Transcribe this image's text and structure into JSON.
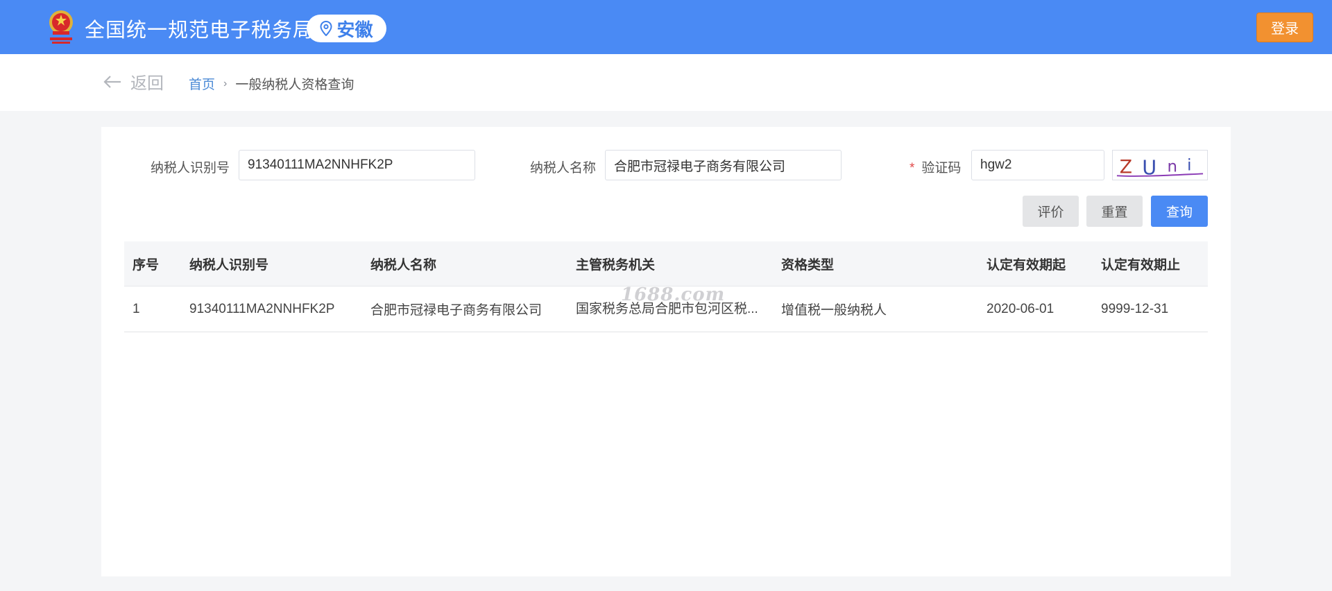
{
  "header": {
    "site_title": "全国统一规范电子税务局",
    "region": "安徽",
    "login_label": "登录",
    "brand_color": "#4a8af4",
    "login_color": "#f29130"
  },
  "breadcrumb": {
    "back_label": "返回",
    "home": "首页",
    "current": "一般纳税人资格查询"
  },
  "form": {
    "taxpayer_id_label": "纳税人识别号",
    "taxpayer_id_value": "91340111MA2NNHFK2P",
    "taxpayer_name_label": "纳税人名称",
    "taxpayer_name_value": "合肥市冠禄电子商务有限公司",
    "captcha_required_mark": "*",
    "captcha_label": "验证码",
    "captcha_value": "hgw2",
    "captcha_image_text": "ZUni"
  },
  "actions": {
    "evaluate_label": "评价",
    "reset_label": "重置",
    "query_label": "查询"
  },
  "table": {
    "columns": [
      "序号",
      "纳税人识别号",
      "纳税人名称",
      "主管税务机关",
      "资格类型",
      "认定有效期起",
      "认定有效期止"
    ],
    "rows": [
      [
        "1",
        "91340111MA2NNHFK2P",
        "合肥市冠禄电子商务有限公司",
        "国家税务总局合肥市包河区税...",
        "增值税一般纳税人",
        "2020-06-01",
        "9999-12-31"
      ]
    ]
  },
  "watermark": "1688.com"
}
